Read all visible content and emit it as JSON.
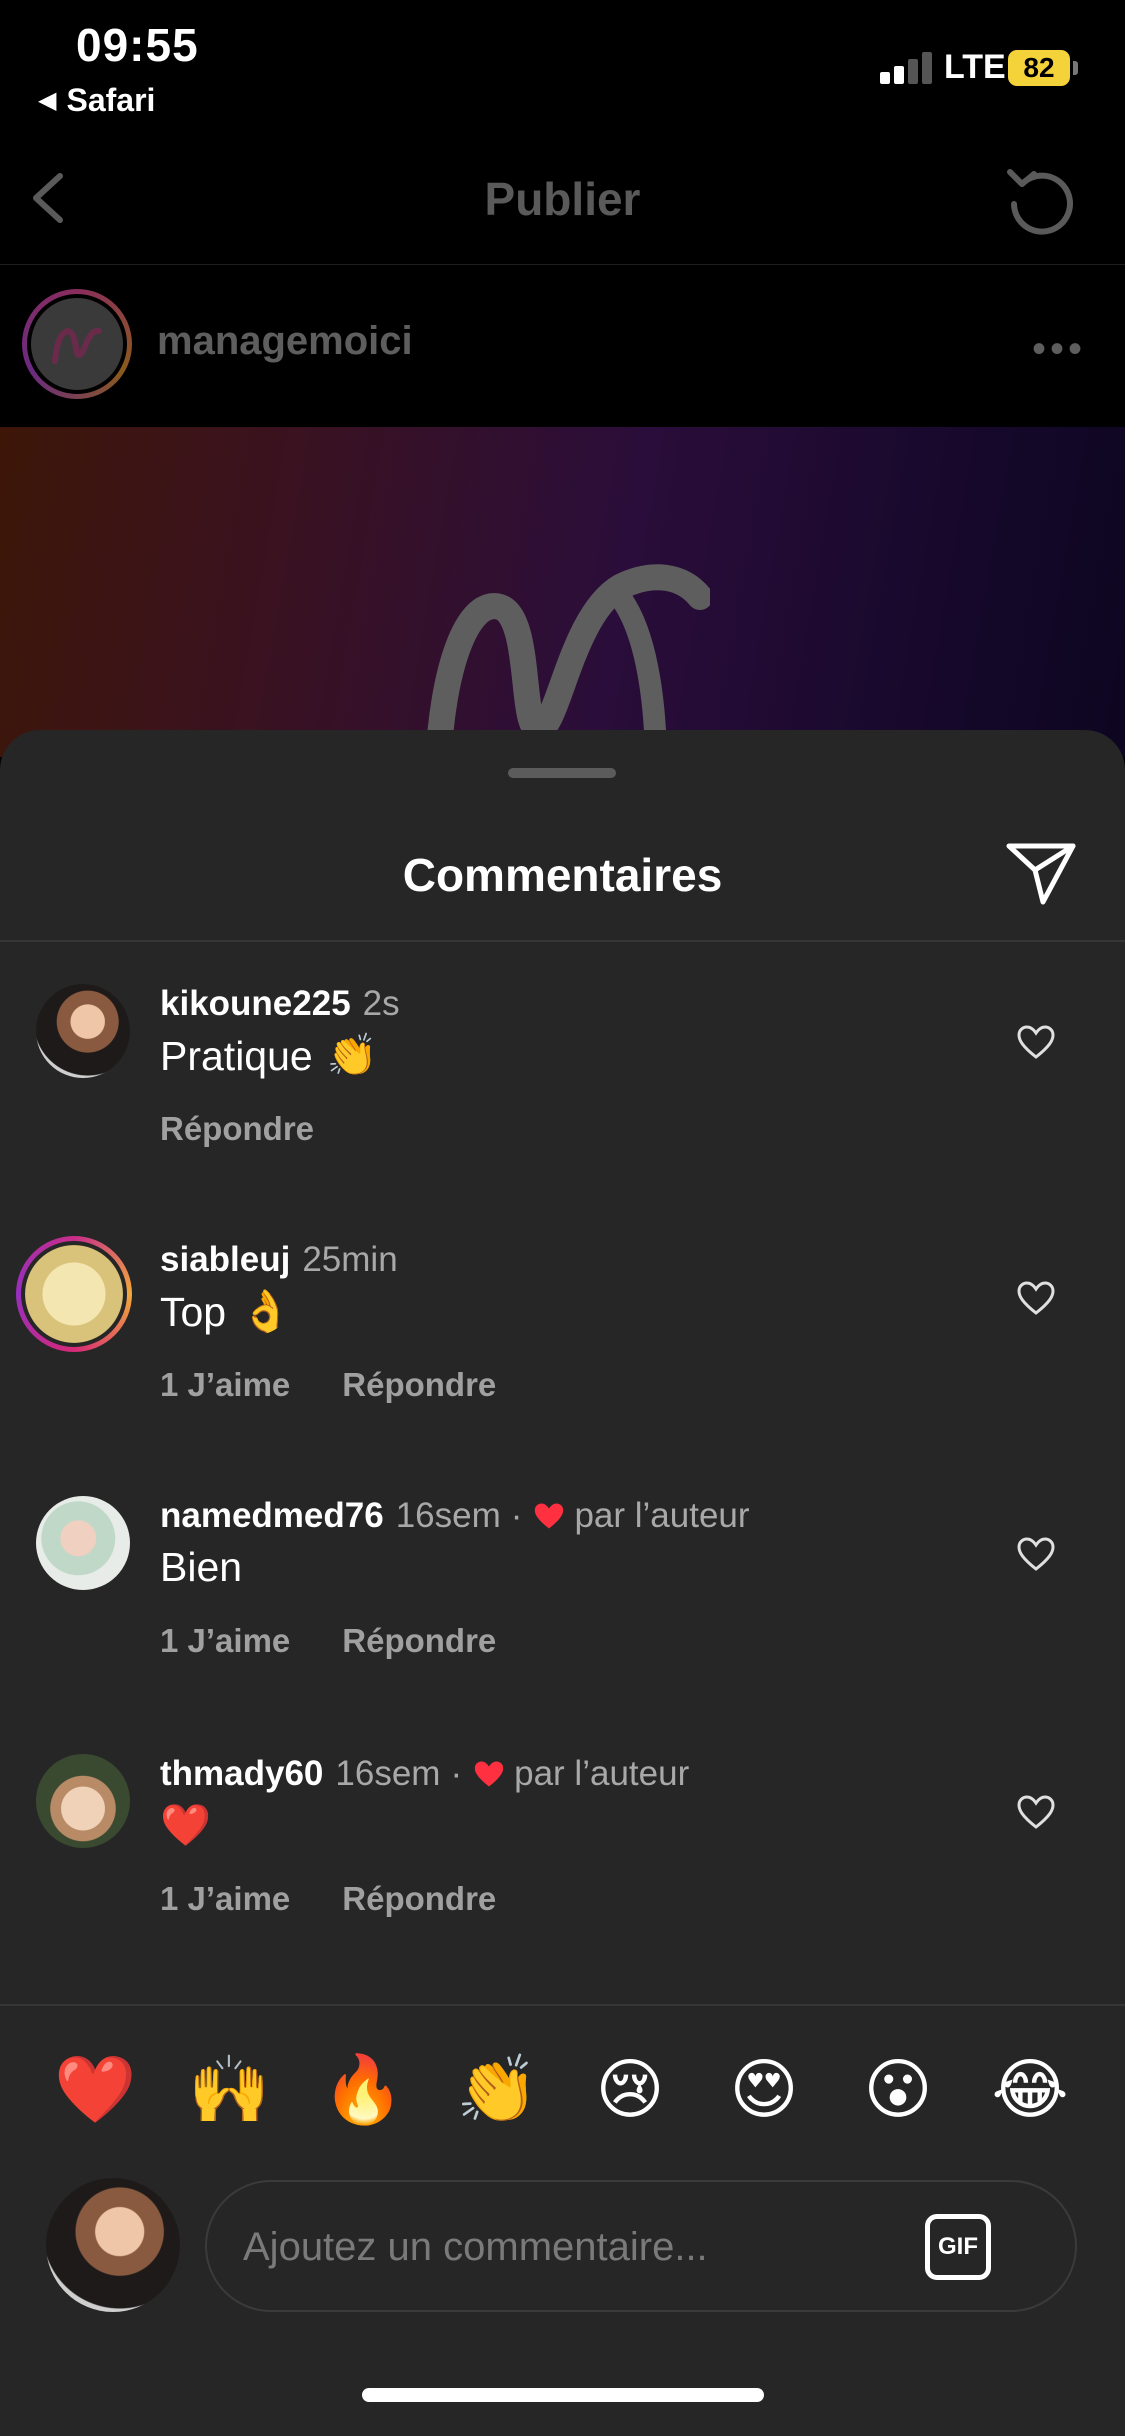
{
  "status_bar": {
    "time": "09:55",
    "back_app": "Safari",
    "network": "LTE",
    "battery": "82"
  },
  "post_header": {
    "title": "Publier",
    "author": "managemoici"
  },
  "comments_sheet": {
    "title": "Commentaires",
    "comments": [
      {
        "username": "kikoune225",
        "time": "2s",
        "text": "Pratique",
        "emoji": "👏",
        "likes": "",
        "reply": "Répondre",
        "author_liked": ""
      },
      {
        "username": "siableuj",
        "time": "25min",
        "text": "Top",
        "emoji": "👌",
        "likes": "1 J’aime",
        "reply": "Répondre",
        "author_liked": ""
      },
      {
        "username": "namedmed76",
        "time": "16sem",
        "text": "Bien",
        "emoji": "",
        "likes": "1 J’aime",
        "reply": "Répondre",
        "author_liked": "par l’auteur"
      },
      {
        "username": "thmady60",
        "time": "16sem",
        "text": "",
        "emoji": "❤️",
        "likes": "1 J’aime",
        "reply": "Répondre",
        "author_liked": "par l’auteur"
      }
    ],
    "quick_emojis": [
      "❤️",
      "🙌",
      "🔥",
      "👏",
      "😢",
      "😍",
      "😮",
      "😂"
    ],
    "composer": {
      "placeholder": "Ajoutez un commentaire...",
      "gif_label": "GIF"
    }
  },
  "colors": {
    "sheet_bg": "#262626",
    "muted_text": "#a8a8a8",
    "heart_red": "#ff3040",
    "battery": "#f4d23a"
  }
}
